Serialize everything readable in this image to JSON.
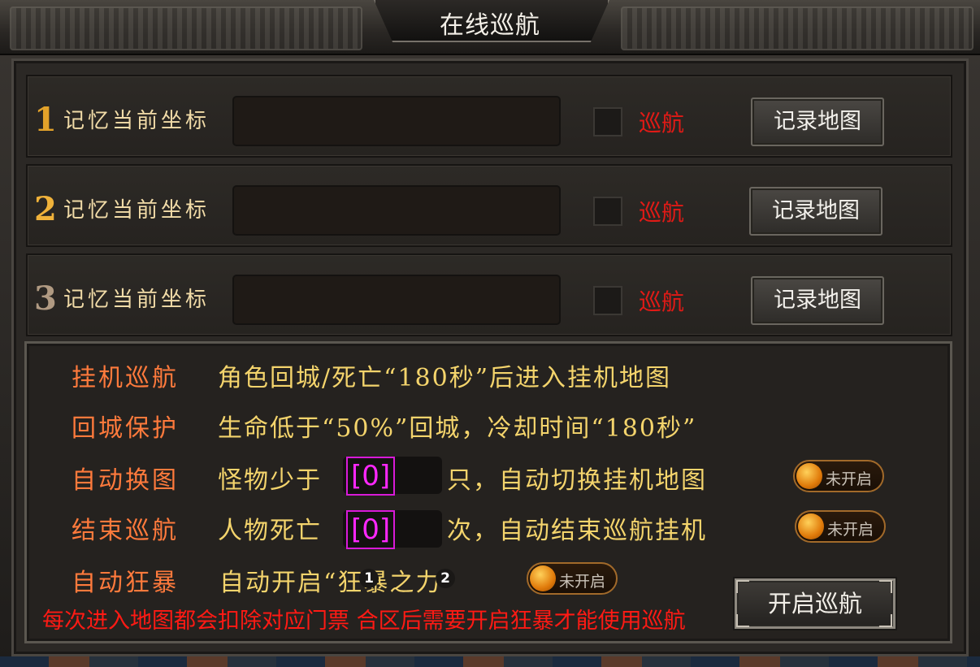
{
  "title": "在线巡航",
  "rows": [
    {
      "num": "1",
      "num_color": "#e2a22a",
      "label": "记忆当前坐标",
      "field_value": "",
      "checked": false,
      "cruise_label": "巡航",
      "button_label": "记录地图"
    },
    {
      "num": "2",
      "num_color": "#f0b23a",
      "label": "记忆当前坐标",
      "field_value": "",
      "checked": false,
      "cruise_label": "巡航",
      "button_label": "记录地图"
    },
    {
      "num": "3",
      "num_color": "#b09a82",
      "label": "记忆当前坐标",
      "field_value": "",
      "checked": false,
      "cruise_label": "巡航",
      "button_label": "记录地图"
    }
  ],
  "options": {
    "hangup": {
      "label": "挂机巡航",
      "text": "角色回城/死亡“180秒”后进入挂机地图"
    },
    "return_protect": {
      "label": "回城保护",
      "text": "生命低于“50%”回城，冷却时间“180秒”"
    },
    "auto_switch": {
      "label": "自动换图",
      "prefix": "怪物少于",
      "value": "[0]",
      "suffix": "只，自动切换挂机地图",
      "toggle": "未开启"
    },
    "end_cruise": {
      "label": "结束巡航",
      "prefix": "人物死亡",
      "value": "[0]",
      "suffix": "次，自动结束巡航挂机",
      "toggle": "未开启"
    },
    "auto_berserk": {
      "label": "自动狂暴",
      "text": "自动开启“狂暴之力”",
      "toggle": "未开启"
    }
  },
  "badges": [
    "1",
    "2"
  ],
  "notice": "每次进入地图都会扣除对应门票  合区后需要开启狂暴才能使用巡航",
  "start_button": "开启巡航",
  "colors": {
    "accent_red": "#e11a16",
    "option_label": "#ff7a3c",
    "option_text": "#f4d46c",
    "value_magenta": "#ff28ff"
  }
}
